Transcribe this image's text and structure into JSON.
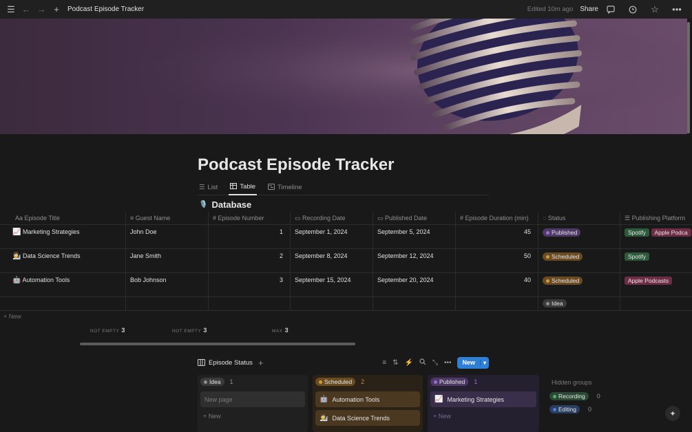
{
  "topbar": {
    "title": "Podcast Episode Tracker",
    "edited": "Edited 10m ago",
    "share": "Share"
  },
  "page": {
    "title": "Podcast Episode Tracker",
    "views": [
      {
        "label": "List",
        "icon": "list-icon"
      },
      {
        "label": "Table",
        "icon": "table-icon",
        "active": true
      },
      {
        "label": "Timeline",
        "icon": "timeline-icon"
      }
    ],
    "database_title": "Database",
    "database_icon": "microphone-emoji"
  },
  "table": {
    "columns": [
      "Episode Title",
      "Guest Name",
      "Episode Number",
      "Recording Date",
      "Published Date",
      "Episode Duration (min)",
      "Status",
      "Publishing Platform"
    ],
    "column_prefix": "Aa",
    "rows": [
      {
        "icon": "📈",
        "title": "Marketing Strategies",
        "guest": "John Doe",
        "number": "1",
        "recorded": "September 1, 2024",
        "published": "September 5, 2024",
        "duration": "45",
        "status": "Published",
        "platforms": [
          "Spotify",
          "Apple Podca"
        ]
      },
      {
        "icon": "👩‍🔬",
        "title": "Data Science Trends",
        "guest": "Jane Smith",
        "number": "2",
        "recorded": "September 8, 2024",
        "published": "September 12, 2024",
        "duration": "50",
        "status": "Scheduled",
        "platforms": [
          "Spotify"
        ]
      },
      {
        "icon": "🤖",
        "title": "Automation Tools",
        "guest": "Bob Johnson",
        "number": "3",
        "recorded": "September 15, 2024",
        "published": "September 20, 2024",
        "duration": "40",
        "status": "Scheduled",
        "platforms": [
          "Apple Podcasts"
        ]
      }
    ],
    "empty_row_status": "Idea",
    "new_label": "New",
    "calcs": [
      {
        "label": "NOT EMPTY",
        "value": "3"
      },
      {
        "label": "NOT EMPTY",
        "value": "3"
      },
      {
        "label": "MAX",
        "value": "3"
      }
    ]
  },
  "board": {
    "title": "Episode Status",
    "new_button": "New",
    "groups": [
      {
        "label": "Idea",
        "count": "1",
        "cards": [],
        "placeholder": "New page",
        "add": "New"
      },
      {
        "label": "Scheduled",
        "count": "2",
        "cards": [
          {
            "icon": "🤖",
            "title": "Automation Tools"
          },
          {
            "icon": "👩‍🔬",
            "title": "Data Science Trends"
          }
        ]
      },
      {
        "label": "Published",
        "count": "1",
        "cards": [
          {
            "icon": "📈",
            "title": "Marketing Strategies"
          }
        ],
        "add": "New"
      }
    ],
    "hidden_title": "Hidden groups",
    "hidden": [
      {
        "label": "Recording",
        "count": "0"
      },
      {
        "label": "Editing",
        "count": "0"
      }
    ]
  },
  "colors": {
    "published": "#9b6cd4",
    "scheduled": "#d09a3c",
    "idea": "#8f8f8f",
    "recording": "#4fae6a",
    "editing": "#4f7fd8",
    "accent": "#2f7fd6"
  }
}
